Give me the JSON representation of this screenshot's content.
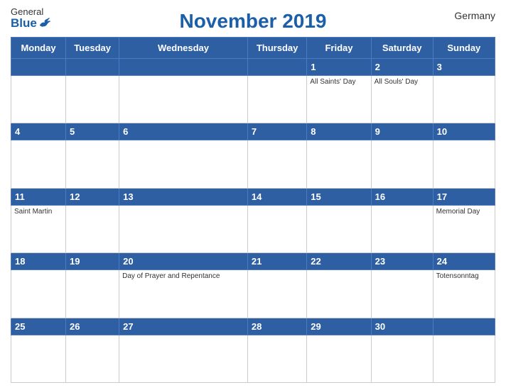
{
  "header": {
    "logo_general": "General",
    "logo_blue": "Blue",
    "title": "November 2019",
    "country": "Germany"
  },
  "weekdays": [
    "Monday",
    "Tuesday",
    "Wednesday",
    "Thursday",
    "Friday",
    "Saturday",
    "Sunday"
  ],
  "weeks": [
    {
      "numbers": [
        "",
        "",
        "",
        "",
        "1",
        "2",
        "3"
      ],
      "events": [
        "",
        "",
        "",
        "",
        "All Saints' Day",
        "All Souls' Day",
        ""
      ]
    },
    {
      "numbers": [
        "4",
        "5",
        "6",
        "7",
        "8",
        "9",
        "10"
      ],
      "events": [
        "",
        "",
        "",
        "",
        "",
        "",
        ""
      ]
    },
    {
      "numbers": [
        "11",
        "12",
        "13",
        "14",
        "15",
        "16",
        "17"
      ],
      "events": [
        "Saint Martin",
        "",
        "",
        "",
        "",
        "",
        "Memorial Day"
      ]
    },
    {
      "numbers": [
        "18",
        "19",
        "20",
        "21",
        "22",
        "23",
        "24"
      ],
      "events": [
        "",
        "",
        "Day of Prayer and Repentance",
        "",
        "",
        "",
        "Totensonntag"
      ]
    },
    {
      "numbers": [
        "25",
        "26",
        "27",
        "28",
        "29",
        "30",
        ""
      ],
      "events": [
        "",
        "",
        "",
        "",
        "",
        "",
        ""
      ]
    }
  ]
}
